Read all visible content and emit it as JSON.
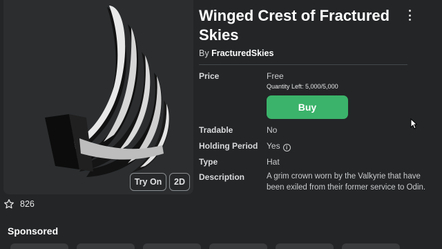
{
  "item": {
    "title": "Winged Crest of Fractured Skies",
    "by_prefix": "By",
    "creator": "FracturedSkies"
  },
  "thumbnail": {
    "try_on_label": "Try On",
    "view_2d_label": "2D"
  },
  "favorites": {
    "count": "826"
  },
  "details": {
    "price_label": "Price",
    "price_value": "Free",
    "quantity_left": "Quantity Left: 5,000/5,000",
    "buy_label": "Buy",
    "tradable_label": "Tradable",
    "tradable_value": "No",
    "holding_label": "Holding Period",
    "holding_value": "Yes",
    "type_label": "Type",
    "type_value": "Hat",
    "description_label": "Description",
    "description_value": "A grim crown worn by the Valkyrie that have been exiled from their former service to Odin."
  },
  "sponsored": {
    "title": "Sponsored"
  },
  "colors": {
    "buy_button": "#3bb36a",
    "background": "#232527"
  }
}
